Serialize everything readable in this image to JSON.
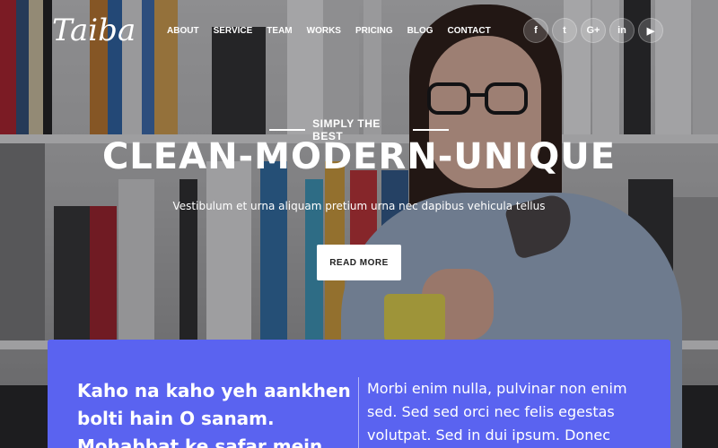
{
  "brand": {
    "logo_text": "Taiba"
  },
  "nav": {
    "items": [
      "ABOUT",
      "SERVICE",
      "TEAM",
      "WORKS",
      "PRICING",
      "BLOG",
      "CONTACT"
    ]
  },
  "social": [
    {
      "icon": "facebook-icon",
      "glyph": "f"
    },
    {
      "icon": "twitter-icon",
      "glyph": "t"
    },
    {
      "icon": "google-plus-icon",
      "glyph": "G+"
    },
    {
      "icon": "linkedin-icon",
      "glyph": "in"
    },
    {
      "icon": "youtube-icon",
      "glyph": "▶"
    }
  ],
  "hero": {
    "tagline": "SIMPLY THE BEST",
    "headline": "CLEAN-MODERN-UNIQUE",
    "subline": "Vestibulum et urna aliquam pretium urna nec dapibus vehicula tellus",
    "button_label": "READ MORE"
  },
  "card": {
    "title": "Kaho na kaho yeh aankhen bolti hain O sanam. Mohabbat ke safar mein",
    "text": "Morbi enim nulla, pulvinar non enim sed. Sed sed orci nec felis egestas volutpat. Sed in dui ipsum. Donec"
  },
  "colors": {
    "card_bg": "#5a63f0",
    "button_bg": "#ffffff",
    "text": "#ffffff"
  }
}
